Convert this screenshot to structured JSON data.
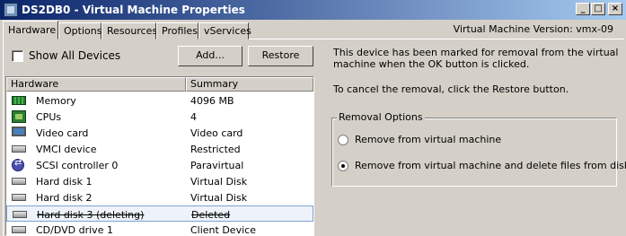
{
  "window": {
    "title": "DS2DB0 - Virtual Machine Properties",
    "version": "Virtual Machine Version: vmx-09"
  },
  "titlebar_buttons": [
    "_",
    "□",
    "×"
  ],
  "tabs": [
    "Hardware",
    "Options",
    "Resources",
    "Profiles",
    "vServices"
  ],
  "active_tab": "Hardware",
  "toolbar": {
    "show_all_label": "Show All Devices",
    "show_all_checked": false,
    "add_label": "Add...",
    "restore_label": "Restore"
  },
  "hardware_list": {
    "headers": [
      "Hardware",
      "Summary"
    ],
    "rows": [
      {
        "name": "Memory",
        "summary": "4096 MB",
        "icon": "memory-icon"
      },
      {
        "name": "CPUs",
        "summary": "4",
        "icon": "cpu-icon"
      },
      {
        "name": "Video card",
        "summary": "Video card",
        "icon": "video-card-icon"
      },
      {
        "name": "VMCI device",
        "summary": "Restricted",
        "icon": "vmci-device-icon"
      },
      {
        "name": "SCSI controller 0",
        "summary": "Paravirtual",
        "icon": "scsi-controller-icon"
      },
      {
        "name": "Hard disk 1",
        "summary": "Virtual Disk",
        "icon": "hard-disk-icon"
      },
      {
        "name": "Hard disk 2",
        "summary": "Virtual Disk",
        "icon": "hard-disk-icon"
      },
      {
        "name": "Hard disk 3 (deleting)",
        "summary": "Deleted",
        "icon": "hard-disk-icon",
        "selected": true,
        "deleted": true
      },
      {
        "name": "CD/DVD drive 1",
        "summary": "Client Device",
        "icon": "cd-dvd-drive-icon"
      }
    ]
  },
  "info": {
    "message": "This device has been marked for removal from the virtual machine when the OK button is clicked.",
    "restore_hint": "To cancel the removal, click the Restore button."
  },
  "removal_options": {
    "title": "Removal Options",
    "options": [
      {
        "label": "Remove from virtual machine",
        "checked": false
      },
      {
        "label": "Remove from virtual machine and delete files from disk",
        "checked": true
      }
    ]
  }
}
